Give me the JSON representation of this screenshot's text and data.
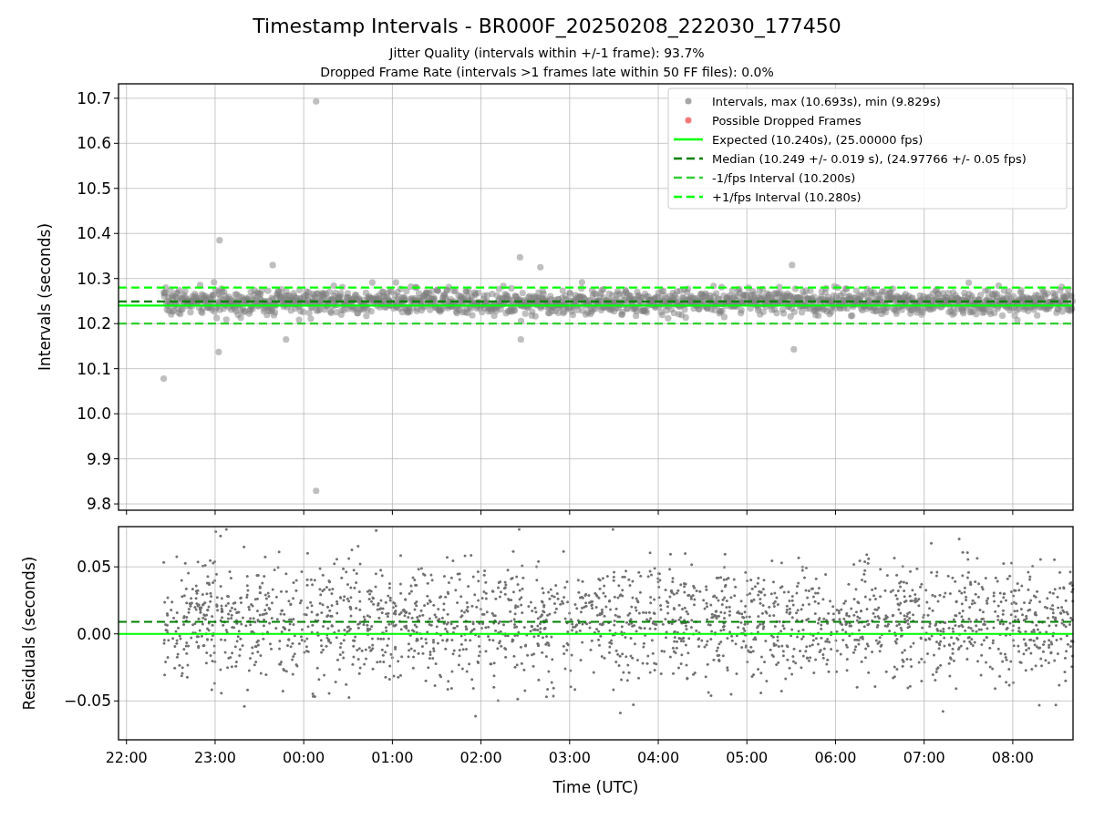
{
  "figure": {
    "title": "Timestamp Intervals - BR000F_20250208_222030_177450",
    "subtitles": [
      "Jitter Quality (intervals within +/-1 frame): 93.7%",
      "Dropped Frame Rate (intervals >1 frames late within 50 FF files): 0.0%"
    ]
  },
  "intervals_plot": {
    "legend": [
      {
        "color": "#a6a6a6",
        "label": "Intervals, max (10.693s), min (9.829s)"
      },
      {
        "color": "#f47a7a",
        "label": "Possible Dropped Frames"
      }
    ],
    "chart_data": {
      "type": "line",
      "ylabel": "Intervals (seconds)",
      "grid": true,
      "legend": "upper right",
      "categories": [
        null,
        null,
        null,
        null,
        null,
        null,
        null,
        null,
        null,
        null,
        null
      ],
      "ylim": [
        9.786,
        10.732
      ],
      "yticks": [
        {
          "value": 9.8,
          "label": "9.8"
        },
        {
          "value": 9.9,
          "label": "9.9"
        },
        {
          "value": 10.0,
          "label": "10.0"
        },
        {
          "value": 10.1,
          "label": "10.1"
        },
        {
          "value": 10.2,
          "label": "10.2"
        },
        {
          "value": 10.3,
          "label": "10.3"
        },
        {
          "value": 10.4,
          "label": "10.4"
        },
        {
          "value": 10.5,
          "label": "10.5"
        },
        {
          "value": 10.6,
          "label": "10.6"
        },
        {
          "value": 10.7,
          "label": "10.7"
        }
      ],
      "ref_lines": [
        {
          "axis": "y",
          "value": 10.24,
          "label": "Expected (10.240s), (25.00000 fps)",
          "color": "#00ff00",
          "line_style": "solid"
        },
        {
          "axis": "y",
          "value": 10.249,
          "label": "Median (10.249 +/- 0.019 s), (24.97766 +/- 0.05 fps)",
          "color": "#008000",
          "line_style": "dashed"
        },
        {
          "axis": "y",
          "value": 10.2,
          "label": "-1/fps Interval (10.200s)",
          "color": "#32cd32",
          "line_style": "dashed"
        },
        {
          "axis": "y",
          "value": 10.28,
          "label": "+1/fps Interval (10.280s)",
          "color": "#00ff00",
          "line_style": "dashed"
        }
      ]
    }
  },
  "residuals_plot": {
    "chart_data": {
      "type": "line",
      "xlabel": "Time (UTC)",
      "ylabel": "Residuals (seconds)",
      "grid": true,
      "categories": [
        "22:00",
        "23:00",
        "00:00",
        "01:00",
        "02:00",
        "03:00",
        "04:00",
        "05:00",
        "06:00",
        "07:00",
        "08:00"
      ],
      "ylim": [
        -0.079,
        0.08
      ],
      "yticks": [
        {
          "value": -0.05,
          "label": "−0.05"
        },
        {
          "value": 0,
          "label": "0.00"
        },
        {
          "value": 0.05,
          "label": "0.05"
        }
      ],
      "ref_lines": [
        {
          "axis": "y",
          "value": 0,
          "color": "#00ff00",
          "line_style": "solid"
        },
        {
          "axis": "y",
          "value": 0.009,
          "color": "#008000",
          "line_style": "dashed"
        }
      ]
    }
  }
}
